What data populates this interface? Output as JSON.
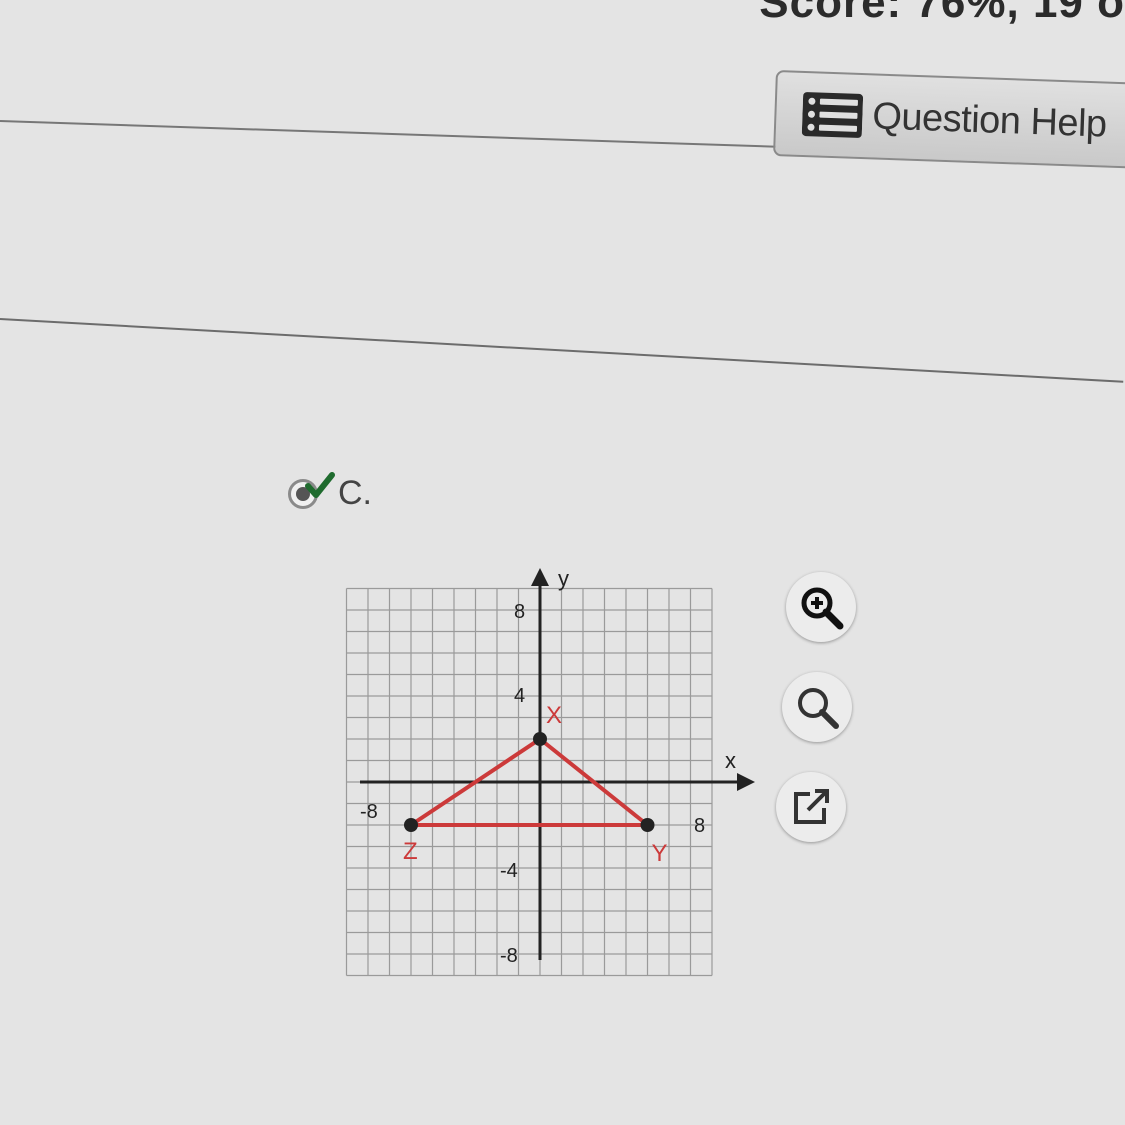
{
  "header": {
    "score_text": "Score: 76%, 19 o"
  },
  "question_help": {
    "label": "Question Help",
    "icon": "list-icon"
  },
  "answer_option": {
    "letter": "C.",
    "selected": true,
    "status_icon": "checkmark-icon"
  },
  "graph": {
    "x_axis_label": "x",
    "y_axis_label": "y",
    "tick_labels": {
      "x_neg8": "-8",
      "x_pos8": "8",
      "y_pos8": "8",
      "y_pos4": "4",
      "y_neg4": "-4",
      "y_neg8": "-8"
    },
    "x_range": [
      -10,
      10
    ],
    "y_range": [
      -10,
      10
    ],
    "grid": true,
    "line_color": "#cc3a3a",
    "points": [
      {
        "name": "X",
        "x": 0,
        "y": 2
      },
      {
        "name": "Y",
        "x": 5,
        "y": -2
      },
      {
        "name": "Z",
        "x": -6,
        "y": -2
      }
    ]
  },
  "tools": [
    {
      "name": "zoom-in-icon"
    },
    {
      "name": "zoom-out-icon"
    },
    {
      "name": "open-new-window-icon"
    }
  ]
}
